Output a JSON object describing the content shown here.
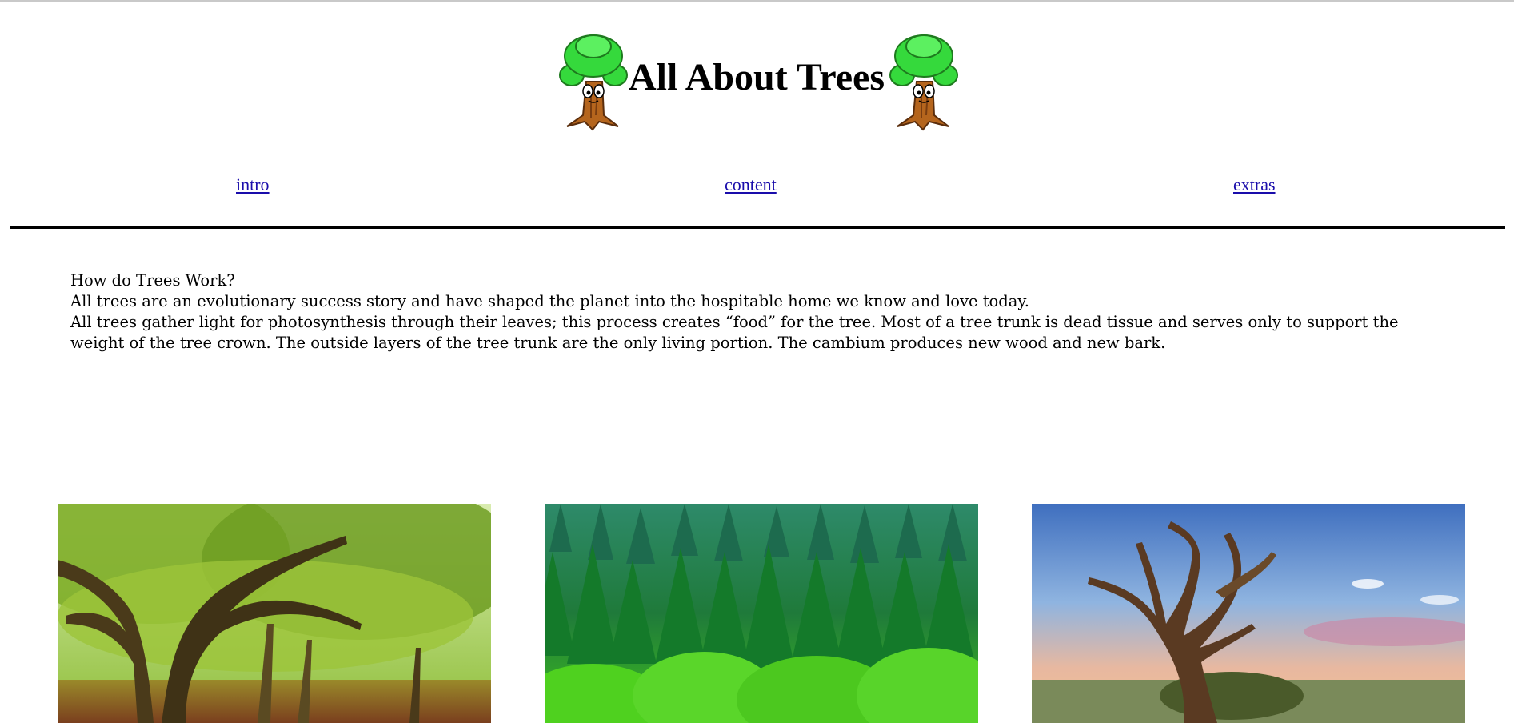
{
  "header": {
    "title": "All About Trees",
    "logo_icon": "cartoon-tree-icon"
  },
  "nav": {
    "items": [
      {
        "label": "intro"
      },
      {
        "label": "content"
      },
      {
        "label": "extras"
      }
    ]
  },
  "main": {
    "heading": "How do Trees Work?",
    "paragraph1": "All trees are an evolutionary success story and have shaped the planet into the hospitable home we know and love today.",
    "paragraph2": "All trees gather light for photosynthesis through their leaves; this process creates “food” for the tree. Most of a tree trunk is dead tissue and serves only to support the weight of the tree crown. The outside layers of the tree trunk are the only living portion. The cambium produces new wood and new bark."
  },
  "gallery": {
    "images": [
      {
        "subject": "sunlit deciduous forest"
      },
      {
        "subject": "dense conifer forest"
      },
      {
        "subject": "gnarled dead tree at sunset"
      }
    ]
  },
  "colors": {
    "link": "#1a0dab",
    "rule": "#000000",
    "tree_crown": "#2ecc40",
    "tree_trunk": "#b5651d"
  }
}
